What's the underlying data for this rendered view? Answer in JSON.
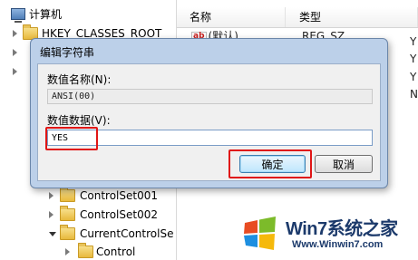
{
  "registry": {
    "tree": {
      "root": "计算机",
      "items": [
        {
          "label": "HKEY_CLASSES_ROOT"
        },
        {
          "label": "ControlSet001"
        },
        {
          "label": "ControlSet002"
        },
        {
          "label": "CurrentControlSe"
        },
        {
          "label": "Control"
        }
      ]
    },
    "list": {
      "columns": {
        "name": "名称",
        "type": "类型"
      },
      "rows": [
        {
          "name": "(默认)",
          "type": "REG_SZ"
        }
      ],
      "right_edge_letters": [
        "Y",
        "Y",
        "Y",
        "N"
      ]
    }
  },
  "dialog": {
    "title": "编辑字符串",
    "name_label": "数值名称(N):",
    "name_value": "ANSI(00)",
    "data_label": "数值数据(V):",
    "data_value": "YES",
    "ok_label": "确定",
    "cancel_label": "取消"
  },
  "watermark": {
    "main": "Win7系统之家",
    "url": "Www.Winwin7.com"
  },
  "colors": {
    "highlight_box": "#e01616",
    "dialog_frame": "#bcd0e9"
  }
}
